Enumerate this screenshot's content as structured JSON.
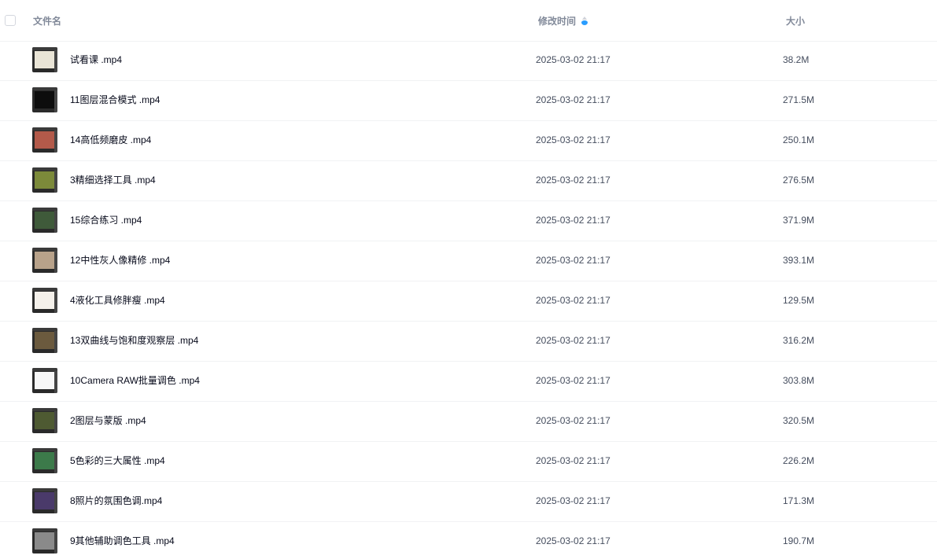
{
  "header": {
    "name_label": "文件名",
    "time_label": "修改时间",
    "size_label": "大小",
    "sort_icon": "sort-desc-icon"
  },
  "files": [
    {
      "name": "试看课 .mp4",
      "time": "2025-03-02 21:17",
      "size": "38.2M",
      "thumb_color": "#e9e4d6"
    },
    {
      "name": "11图层混合模式 .mp4",
      "time": "2025-03-02 21:17",
      "size": "271.5M",
      "thumb_color": "#0d0d0d"
    },
    {
      "name": "14高低频磨皮 .mp4",
      "time": "2025-03-02 21:17",
      "size": "250.1M",
      "thumb_color": "#b35a4a"
    },
    {
      "name": "3精细选择工具 .mp4",
      "time": "2025-03-02 21:17",
      "size": "276.5M",
      "thumb_color": "#7c8a3a"
    },
    {
      "name": "15综合练习 .mp4",
      "time": "2025-03-02 21:17",
      "size": "371.9M",
      "thumb_color": "#3f5a3a"
    },
    {
      "name": "12中性灰人像精修 .mp4",
      "time": "2025-03-02 21:17",
      "size": "393.1M",
      "thumb_color": "#b8a28a"
    },
    {
      "name": "4液化工具修胖瘦 .mp4",
      "time": "2025-03-02 21:17",
      "size": "129.5M",
      "thumb_color": "#f4f0ea"
    },
    {
      "name": "13双曲线与饱和度观察层 .mp4",
      "time": "2025-03-02 21:17",
      "size": "316.2M",
      "thumb_color": "#6b5a3e"
    },
    {
      "name": "10Camera RAW批量调色 .mp4",
      "time": "2025-03-02 21:17",
      "size": "303.8M",
      "thumb_color": "#f7f7f7"
    },
    {
      "name": "2图层与蒙版 .mp4",
      "time": "2025-03-02 21:17",
      "size": "320.5M",
      "thumb_color": "#4e5a32"
    },
    {
      "name": "5色彩的三大属性 .mp4",
      "time": "2025-03-02 21:17",
      "size": "226.2M",
      "thumb_color": "#3c7a4a"
    },
    {
      "name": "8照片的氛围色调.mp4",
      "time": "2025-03-02 21:17",
      "size": "171.3M",
      "thumb_color": "#4a3a6a"
    },
    {
      "name": "9其他辅助调色工具 .mp4",
      "time": "2025-03-02 21:17",
      "size": "190.7M",
      "thumb_color": "#8a8a8a"
    }
  ]
}
